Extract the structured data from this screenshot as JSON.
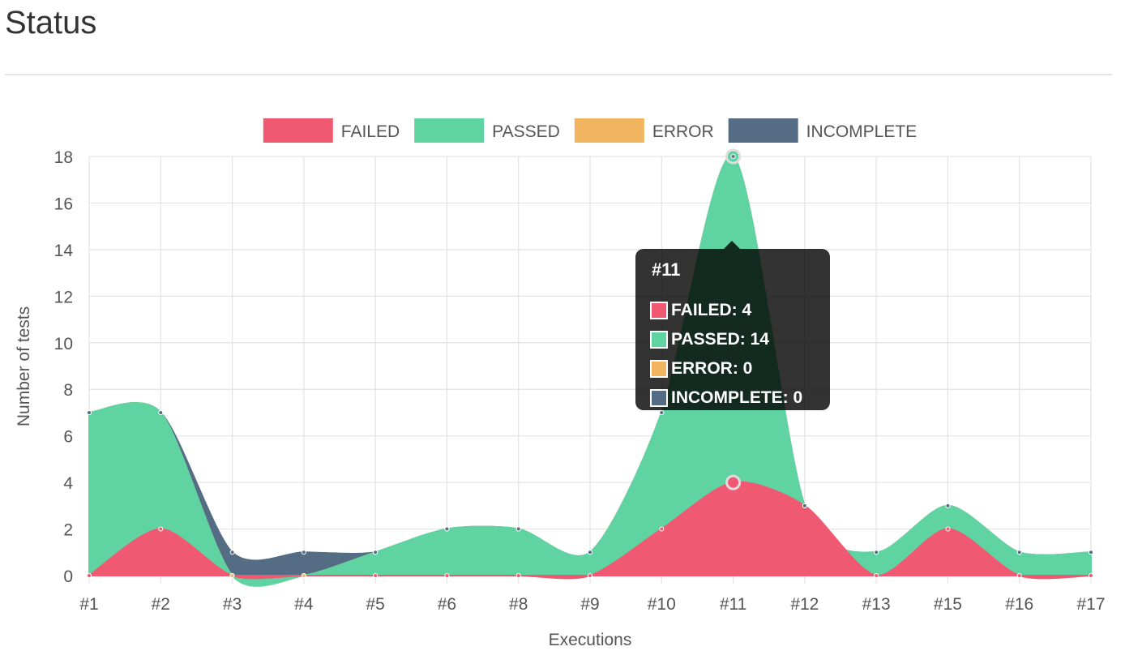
{
  "page": {
    "title": "Status"
  },
  "chart_data": {
    "type": "area",
    "stacked": true,
    "categories": [
      "#1",
      "#2",
      "#3",
      "#4",
      "#5",
      "#6",
      "#8",
      "#9",
      "#10",
      "#11",
      "#12",
      "#13",
      "#15",
      "#16",
      "#17"
    ],
    "series": [
      {
        "name": "FAILED",
        "color": "#ef5a72",
        "values": [
          0,
          2,
          0,
          0,
          0,
          0,
          0,
          0,
          2,
          4,
          3,
          0,
          2,
          0,
          0
        ]
      },
      {
        "name": "PASSED",
        "color": "#5fd3a1",
        "values": [
          7,
          5,
          0,
          0,
          1,
          2,
          2,
          1,
          5,
          14,
          0,
          1,
          1,
          1,
          1
        ]
      },
      {
        "name": "ERROR",
        "color": "#f2b55f",
        "values": [
          0,
          0,
          0,
          0,
          0,
          0,
          0,
          0,
          0,
          0,
          0,
          0,
          0,
          0,
          0
        ]
      },
      {
        "name": "INCOMPLETE",
        "color": "#546d84",
        "values": [
          0,
          0,
          1,
          1,
          0,
          0,
          0,
          0,
          0,
          0,
          0,
          0,
          0,
          0,
          0
        ]
      }
    ],
    "xlabel": "Executions",
    "ylabel": "Number of tests",
    "ylim": [
      0,
      18
    ],
    "yticks": [
      0,
      2,
      4,
      6,
      8,
      10,
      12,
      14,
      16,
      18
    ],
    "grid": true,
    "legend_position": "top-center",
    "highlighted_category": "#11"
  },
  "tooltip": {
    "title": "#11",
    "rows": [
      {
        "label": "FAILED: 4",
        "color": "#ef5a72"
      },
      {
        "label": "PASSED: 14",
        "color": "#5fd3a1"
      },
      {
        "label": "ERROR: 0",
        "color": "#f2b55f"
      },
      {
        "label": "INCOMPLETE: 0",
        "color": "#546d84"
      }
    ]
  }
}
